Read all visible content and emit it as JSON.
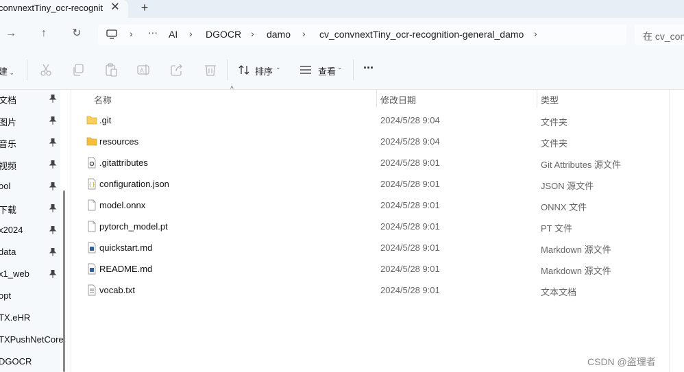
{
  "tab": {
    "title": "convnextTiny_ocr-recogniti",
    "close": "✕",
    "new": "+"
  },
  "nav": {
    "forward": "→",
    "up": "↑",
    "refresh": "↻"
  },
  "breadcrumb": {
    "more": "···",
    "items": [
      "AI",
      "DGOCR",
      "damo",
      "cv_convnextTiny_ocr-recognition-general_damo"
    ]
  },
  "search": {
    "placeholder": "在 cv_con"
  },
  "toolbar": {
    "new_label": "建",
    "sort_label": "排序",
    "view_label": "查看",
    "more": "···",
    "icons": [
      "cut-icon",
      "copy-icon",
      "paste-icon",
      "rename-icon",
      "share-icon",
      "delete-icon"
    ]
  },
  "sidebar": {
    "items": [
      {
        "label": "文档",
        "pinned": true
      },
      {
        "label": "图片",
        "pinned": true
      },
      {
        "label": "音乐",
        "pinned": true
      },
      {
        "label": "视频",
        "pinned": true
      },
      {
        "label": "ool",
        "pinned": true
      },
      {
        "label": "下载",
        "pinned": true
      },
      {
        "label": "x2024",
        "pinned": true
      },
      {
        "label": "data",
        "pinned": true
      },
      {
        "label": "x1_web",
        "pinned": true
      },
      {
        "label": "opt",
        "pinned": false
      },
      {
        "label": "TX.eHR",
        "pinned": false
      },
      {
        "label": "TXPushNetCore",
        "pinned": false
      },
      {
        "label": "DGOCR",
        "pinned": false
      }
    ]
  },
  "columns": {
    "name": "名称",
    "modified": "修改日期",
    "type": "类型"
  },
  "files": [
    {
      "name": ".git",
      "date": "2024/5/28 9:04",
      "type": "文件夹",
      "icon": "folder-icon"
    },
    {
      "name": "resources",
      "date": "2024/5/28 9:04",
      "type": "文件夹",
      "icon": "folder-icon"
    },
    {
      "name": ".gitattributes",
      "date": "2024/5/28 9:01",
      "type": "Git Attributes 源文件",
      "icon": "gear-file-icon"
    },
    {
      "name": "configuration.json",
      "date": "2024/5/28 9:01",
      "type": "JSON 源文件",
      "icon": "json-file-icon"
    },
    {
      "name": "model.onnx",
      "date": "2024/5/28 9:01",
      "type": "ONNX 文件",
      "icon": "file-icon"
    },
    {
      "name": "pytorch_model.pt",
      "date": "2024/5/28 9:01",
      "type": "PT 文件",
      "icon": "file-icon"
    },
    {
      "name": "quickstart.md",
      "date": "2024/5/28 9:01",
      "type": "Markdown 源文件",
      "icon": "markdown-file-icon"
    },
    {
      "name": "README.md",
      "date": "2024/5/28 9:01",
      "type": "Markdown 源文件",
      "icon": "markdown-file-icon"
    },
    {
      "name": "vocab.txt",
      "date": "2024/5/28 9:01",
      "type": "文本文档",
      "icon": "text-file-icon"
    }
  ],
  "watermark": "CSDN @盗理者"
}
